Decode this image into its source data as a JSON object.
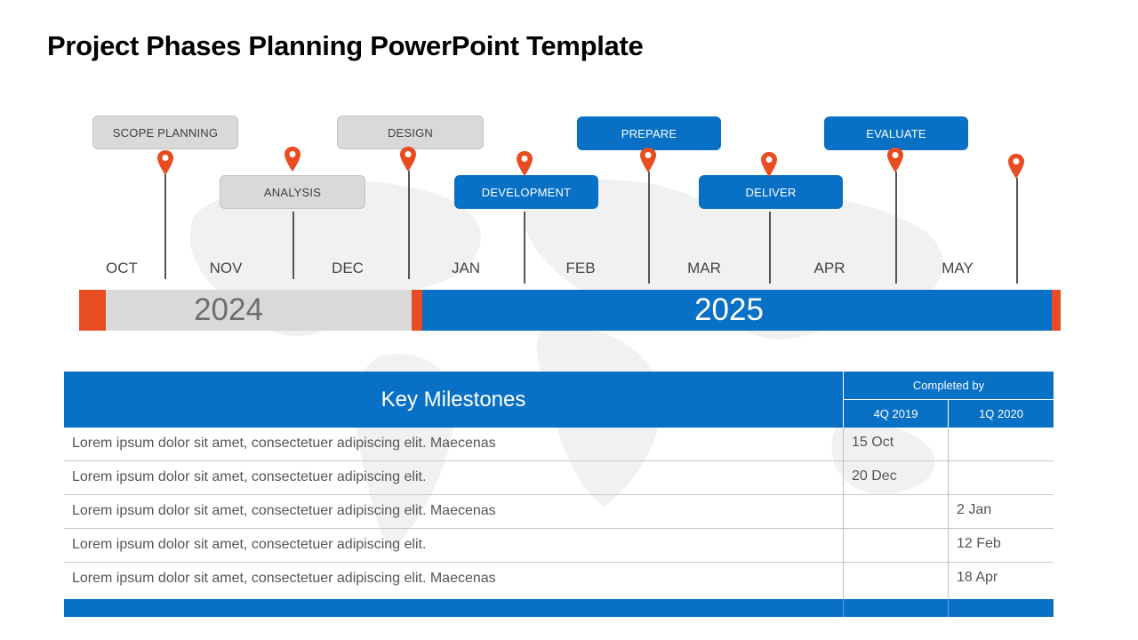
{
  "slide": {
    "title": "Project Phases Planning PowerPoint Template"
  },
  "colors": {
    "accent_blue": "#0870c5",
    "accent_orange": "#e84c22",
    "neutral_gray": "#d9d9d9",
    "text_dark": "#444444"
  },
  "phases": [
    {
      "label": "SCOPE PLANNING",
      "style": "gray",
      "icon": "map-pin-icon"
    },
    {
      "label": "ANALYSIS",
      "style": "gray",
      "icon": "map-pin-icon"
    },
    {
      "label": "DESIGN",
      "style": "gray",
      "icon": "map-pin-icon"
    },
    {
      "label": "DEVELOPMENT",
      "style": "blue",
      "icon": "map-pin-icon"
    },
    {
      "label": "PREPARE",
      "style": "blue",
      "icon": "map-pin-icon"
    },
    {
      "label": "DELIVER",
      "style": "blue",
      "icon": "map-pin-icon"
    },
    {
      "label": "EVALUATE",
      "style": "blue",
      "icon": "map-pin-icon"
    }
  ],
  "extra_pin": {
    "icon": "map-pin-icon"
  },
  "months": [
    "OCT",
    "NOV",
    "DEC",
    "JAN",
    "FEB",
    "MAR",
    "APR",
    "MAY"
  ],
  "years": [
    {
      "label": "2024",
      "months": [
        "OCT",
        "NOV",
        "DEC"
      ]
    },
    {
      "label": "2025",
      "months": [
        "JAN",
        "FEB",
        "MAR",
        "APR",
        "MAY"
      ]
    }
  ],
  "table": {
    "title": "Key Milestones",
    "completed_by": "Completed by",
    "quarters": [
      "4Q 2019",
      "1Q 2020"
    ],
    "rows": [
      {
        "desc": "Lorem ipsum dolor sit amet, consectetuer adipiscing elit.  Maecenas",
        "q1": "15 Oct",
        "q2": ""
      },
      {
        "desc": "Lorem ipsum dolor sit amet, consectetuer adipiscing elit.",
        "q1": "20 Dec",
        "q2": ""
      },
      {
        "desc": "Lorem ipsum dolor sit amet, consectetuer adipiscing elit.  Maecenas",
        "q1": "",
        "q2": "2 Jan"
      },
      {
        "desc": "Lorem ipsum dolor sit amet, consectetuer adipiscing elit.",
        "q1": "",
        "q2": "12 Feb"
      },
      {
        "desc": "Lorem ipsum dolor sit amet, consectetuer adipiscing elit.  Maecenas",
        "q1": "",
        "q2": "18 Apr"
      }
    ]
  }
}
